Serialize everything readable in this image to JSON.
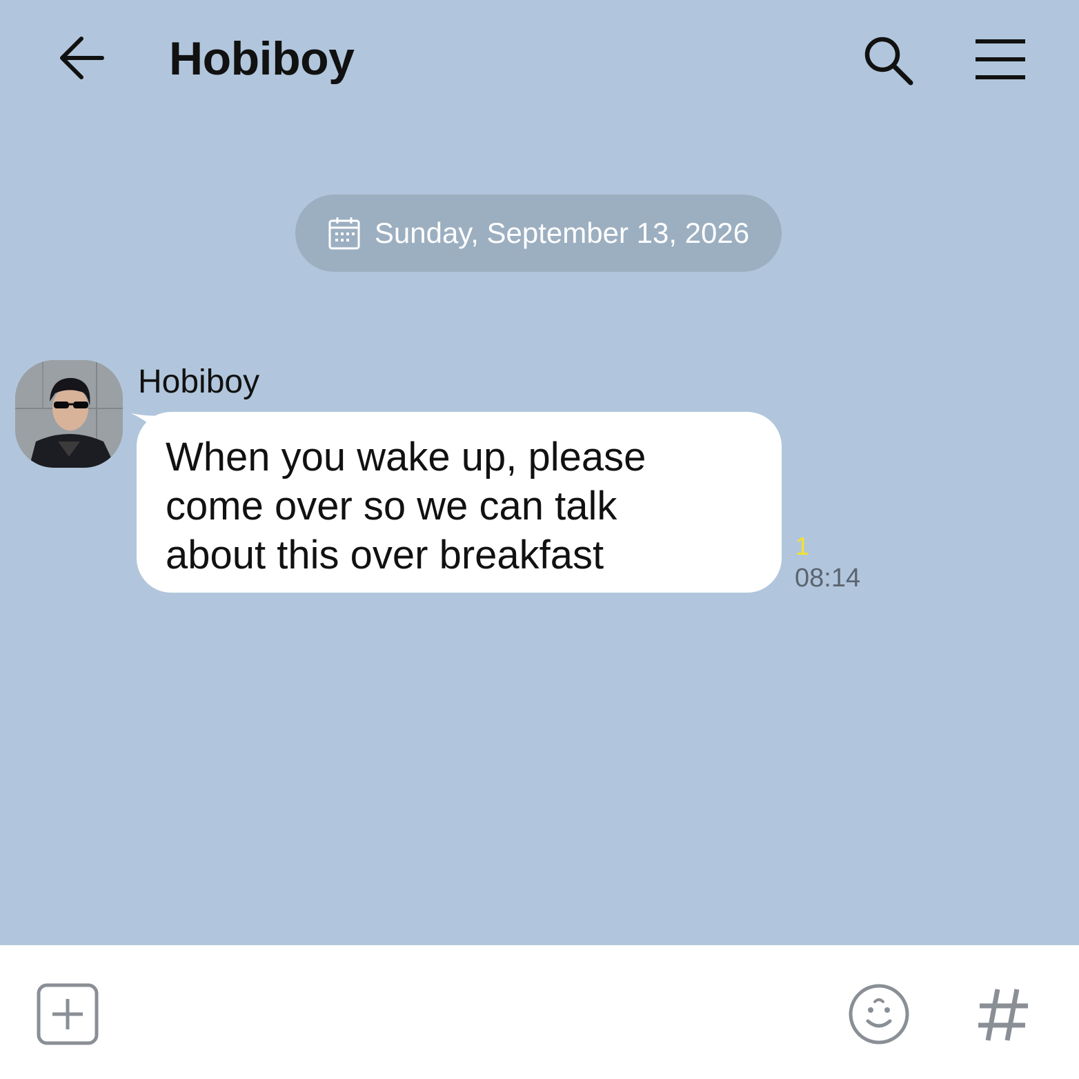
{
  "header": {
    "title": "Hobiboy",
    "back_icon": "arrow-left-icon",
    "search_icon": "search-icon",
    "menu_icon": "hamburger-menu-icon"
  },
  "date_divider": {
    "icon": "calendar-icon",
    "text": "Sunday, September 13, 2026"
  },
  "messages": [
    {
      "sender": "Hobiboy",
      "avatar": "avatar-photo",
      "text": "When you wake up, please\ncome over so we can talk\nabout this over breakfast",
      "unread_count": "1",
      "time": "08:14"
    }
  ],
  "input_bar": {
    "add_icon": "plus-square-icon",
    "emoji_icon": "smiley-icon",
    "hashtag_icon": "hashtag-icon"
  },
  "colors": {
    "background": "#b1c6dc",
    "date_pill": "#9cafc1",
    "bubble": "#ffffff",
    "unread": "#f5e22a",
    "time": "#5b6470",
    "icon_gray": "#8a8f96"
  }
}
